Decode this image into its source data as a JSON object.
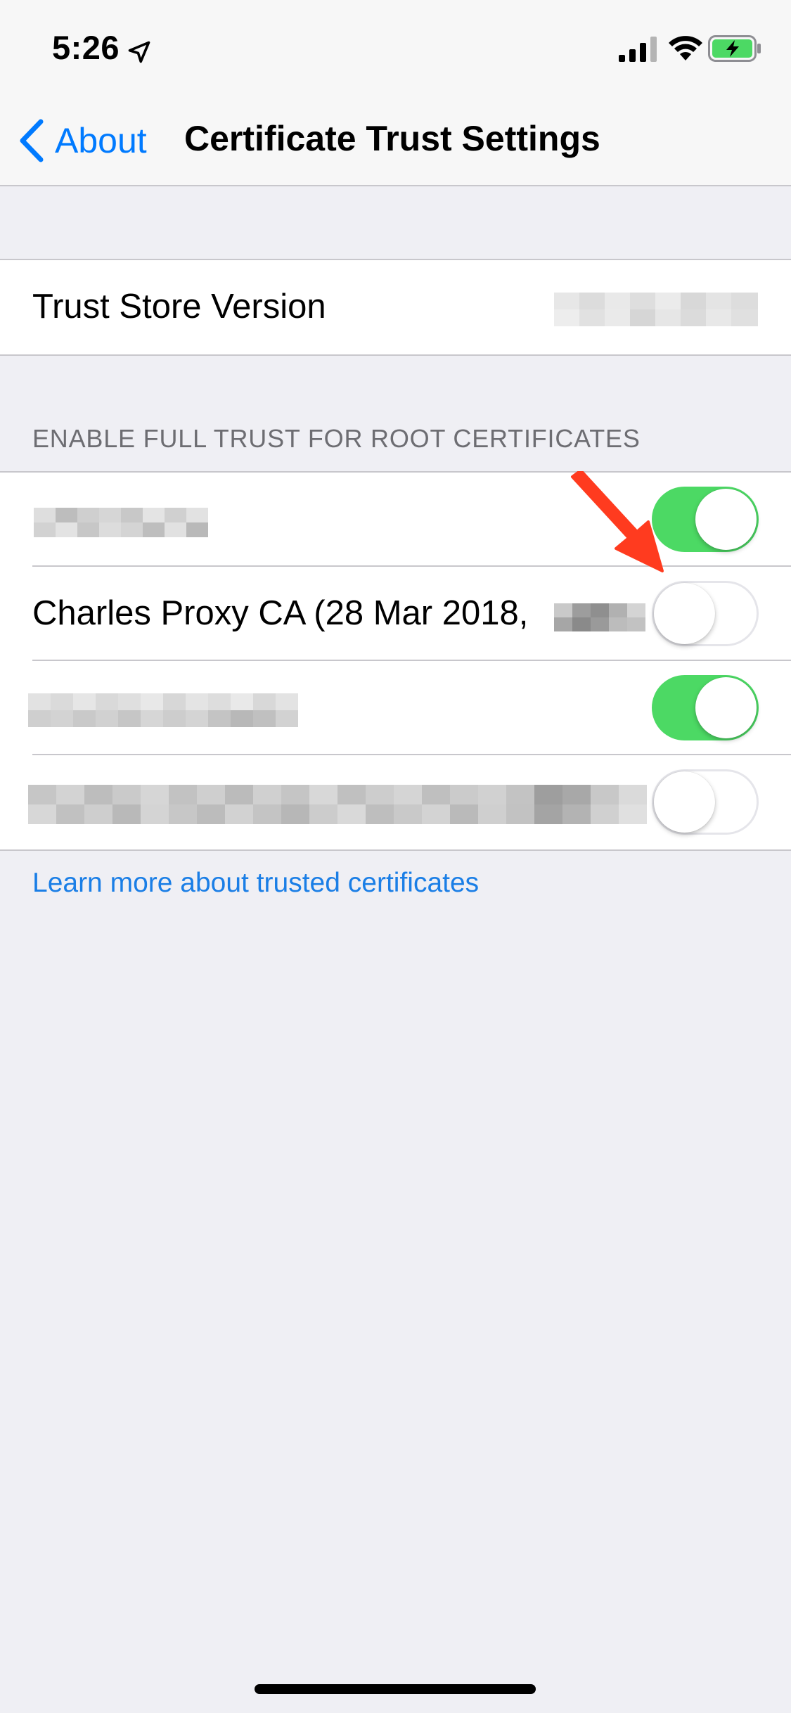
{
  "status_bar": {
    "time": "5:26",
    "icons": [
      "location-arrow-icon",
      "cellular-signal-icon",
      "wifi-icon",
      "battery-charging-icon"
    ],
    "battery_color": "#4cd964"
  },
  "nav": {
    "back_label": "About",
    "title": "Certificate Trust Settings",
    "accent_color": "#007aff"
  },
  "trust_store": {
    "label": "Trust Store Version",
    "value_redacted": true
  },
  "section": {
    "header": "ENABLE FULL TRUST FOR ROOT CERTIFICATES",
    "certificates": [
      {
        "label": "",
        "redacted": true,
        "enabled": true
      },
      {
        "label": "Charles Proxy CA (28 Mar 2018,",
        "redacted_suffix": true,
        "enabled": false
      },
      {
        "label": "",
        "redacted": true,
        "enabled": true
      },
      {
        "label": "",
        "redacted": true,
        "enabled": false
      }
    ]
  },
  "footer": {
    "learn_more": "Learn more about trusted certificates"
  },
  "annotation": {
    "arrow_color": "#ff3b1f",
    "points_to": "Charles Proxy CA toggle"
  },
  "colors": {
    "toggle_on": "#4cd964",
    "background": "#efeff4",
    "link": "#1a7ee6"
  }
}
